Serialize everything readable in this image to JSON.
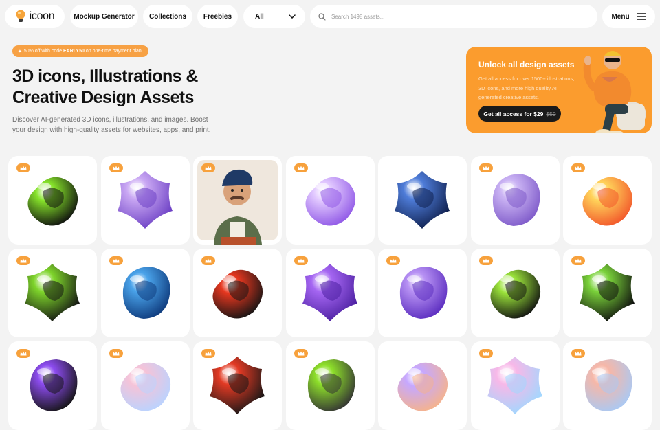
{
  "header": {
    "logo_text": "icoon",
    "nav": [
      "Mockup Generator",
      "Collections",
      "Freebies"
    ],
    "category_select": "All",
    "search_placeholder": "Search 1498 assets...",
    "menu_label": "Menu"
  },
  "promo": {
    "prefix": "50% off with code",
    "code": "EARLY50",
    "suffix": "on one-time payment plan."
  },
  "hero": {
    "title_line1": "3D icons, Illustrations &",
    "title_line2": "Creative Design Assets",
    "description": "Discover AI-generated 3D icons, illustrations, and images. Boost your design with high-quality assets for websites, apps, and print."
  },
  "banner": {
    "title": "Unlock all design assets",
    "description": "Get all access for over 1500+ illustrations, 3D icons, and more high quality AI generated creative assets.",
    "button_label": "Get all access for $29",
    "old_price": "$59",
    "accent": "#fb9c2e"
  },
  "assets": [
    {
      "name": "green-black-knot-render",
      "premium": true,
      "colors": [
        "#0e0e0e",
        "#86e32a"
      ]
    },
    {
      "name": "purple-flower-render",
      "premium": true,
      "colors": [
        "#6b3fc4",
        "#c9a7f3"
      ]
    },
    {
      "name": "cartoon-man-cap-illustration",
      "premium": true,
      "colors": [
        "#5b6e4a",
        "#d9a27a"
      ]
    },
    {
      "name": "violet-glass-blob-render",
      "premium": true,
      "colors": [
        "#8f57e6",
        "#e2c9ff"
      ]
    },
    {
      "name": "navy-ribbon-knot-render",
      "premium": false,
      "colors": [
        "#0f1f4d",
        "#4e7cd8"
      ]
    },
    {
      "name": "lavender-crumpled-render",
      "premium": true,
      "colors": [
        "#7e5ac9",
        "#cbb4f4"
      ]
    },
    {
      "name": "orange-glass-flower-render",
      "premium": true,
      "colors": [
        "#f2562a",
        "#ffd35a"
      ]
    },
    {
      "name": "green-black-swirl-render",
      "premium": true,
      "colors": [
        "#121212",
        "#7ed42b"
      ]
    },
    {
      "name": "blue-glass-knot-render",
      "premium": true,
      "colors": [
        "#0e3a7c",
        "#4aa3ea"
      ]
    },
    {
      "name": "red-black-hook-render",
      "premium": true,
      "colors": [
        "#141414",
        "#e6371f"
      ]
    },
    {
      "name": "purple-gem-render",
      "premium": true,
      "colors": [
        "#4b1fa0",
        "#a566f2"
      ]
    },
    {
      "name": "purple-twist-render",
      "premium": true,
      "colors": [
        "#5b2dbf",
        "#b892f4"
      ]
    },
    {
      "name": "green-black-loop-render",
      "premium": true,
      "colors": [
        "#101010",
        "#9ae23a"
      ]
    },
    {
      "name": "dark-green-ring-render",
      "premium": true,
      "colors": [
        "#0d0d0d",
        "#7ad23a"
      ]
    },
    {
      "name": "purple-black-swirl-render",
      "premium": true,
      "colors": [
        "#141414",
        "#8d4cf0"
      ]
    },
    {
      "name": "pastel-cloud-blob-render",
      "premium": true,
      "colors": [
        "#b9d3ff",
        "#f5c3d8"
      ]
    },
    {
      "name": "red-black-fold-render",
      "premium": true,
      "colors": [
        "#161616",
        "#e23a24"
      ]
    },
    {
      "name": "green-grey-crumple-render",
      "premium": true,
      "colors": [
        "#333333",
        "#8ee02a"
      ]
    },
    {
      "name": "iridescent-orb-render",
      "premium": false,
      "colors": [
        "#f6b38a",
        "#c6a8ff"
      ]
    },
    {
      "name": "holographic-blob-render",
      "premium": true,
      "colors": [
        "#9fd8ff",
        "#f7b8e8"
      ]
    },
    {
      "name": "pastel-bean-render",
      "premium": true,
      "colors": [
        "#a9c9f4",
        "#f6b7a8"
      ]
    }
  ]
}
